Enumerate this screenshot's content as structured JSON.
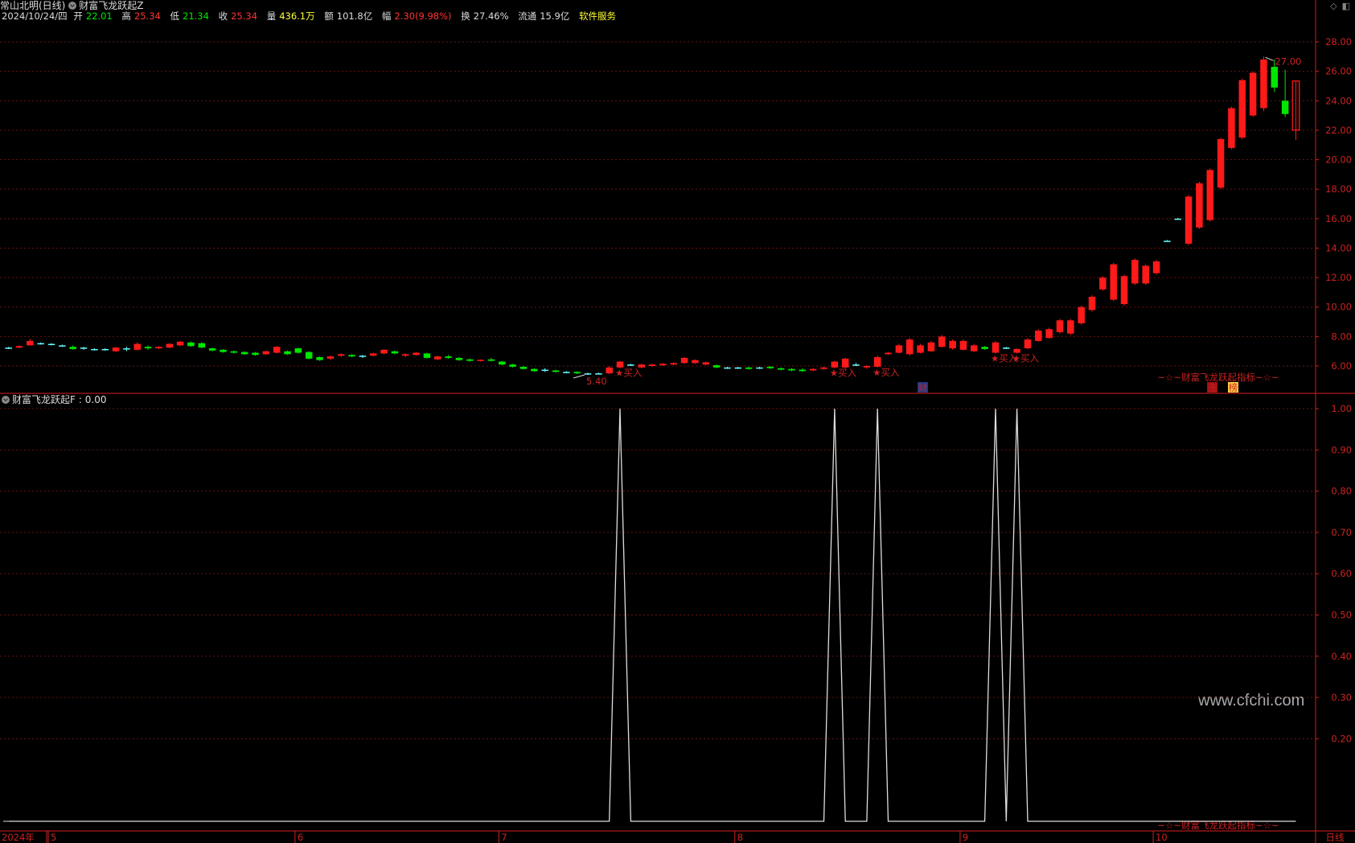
{
  "header": {
    "stock_name": "常山北明(日线)",
    "indicator_main": "财富飞龙跃起Z",
    "date": "2024/10/24/四",
    "open_label": "开",
    "open": "22.01",
    "high_label": "高",
    "high": "25.34",
    "low_label": "低",
    "low": "21.34",
    "close_label": "收",
    "close": "25.34",
    "volume_label": "量",
    "volume": "436.1万",
    "amount_label": "额",
    "amount": "101.8亿",
    "change_label": "幅",
    "change": "2.30(9.98%)",
    "turnover_label": "换",
    "turnover": "27.46%",
    "float_label": "流通",
    "float": "15.9亿",
    "service": "软件服务"
  },
  "toolbar_icons": [
    "diamond-icon",
    "window-icon"
  ],
  "sub_indicator": {
    "name": "财富飞龙跃起F",
    "value": ": 0.00"
  },
  "watermark": "www.cfchi.com",
  "period_label": "日线",
  "year_label": "2024年",
  "main_price_axis": [
    "28.00",
    "26.00",
    "24.00",
    "22.00",
    "20.00",
    "18.00",
    "16.00",
    "14.00",
    "12.00",
    "10.00",
    "8.00",
    "6.00"
  ],
  "sub_axis": [
    "1.00",
    "0.90",
    "0.80",
    "0.70",
    "0.60",
    "0.50",
    "0.40",
    "0.30",
    "0.20"
  ],
  "month_labels": [
    "5",
    "6",
    "7",
    "8",
    "9",
    "10"
  ],
  "annotations": {
    "max_price": "27.00",
    "min_price": "5.40",
    "buy_label": "买入",
    "bottom_banner": "~☆~财富飞龙跃起指标~☆~",
    "tag_cai": "财",
    "tag_zhang": "涨",
    "tag_bang": "榜"
  },
  "colors": {
    "up": "#ff1a1a",
    "down": "#00e600",
    "doji": "#66ffff",
    "axis": "#cc2222",
    "grid": "#6b1010",
    "signal": "#dddddd"
  },
  "chart_data": [
    {
      "type": "candlestick",
      "title": "财富飞龙跃起Z",
      "ylim": [
        5,
        28.5
      ],
      "ohlc": [
        [
          7.2,
          7.3,
          7.15,
          7.25
        ],
        [
          7.25,
          7.4,
          7.2,
          7.35
        ],
        [
          7.4,
          7.85,
          7.4,
          7.7
        ],
        [
          7.55,
          7.6,
          7.45,
          7.5
        ],
        [
          7.45,
          7.55,
          7.4,
          7.5
        ],
        [
          7.4,
          7.45,
          7.3,
          7.35
        ],
        [
          7.3,
          7.4,
          7.1,
          7.15
        ],
        [
          7.2,
          7.3,
          7.1,
          7.25
        ],
        [
          7.1,
          7.2,
          7.05,
          7.15
        ],
        [
          7.15,
          7.2,
          7.05,
          7.1
        ],
        [
          7.0,
          7.3,
          6.95,
          7.25
        ],
        [
          7.2,
          7.3,
          7.0,
          7.15
        ],
        [
          7.1,
          7.6,
          7.05,
          7.5
        ],
        [
          7.3,
          7.4,
          7.1,
          7.2
        ],
        [
          7.2,
          7.35,
          7.15,
          7.3
        ],
        [
          7.25,
          7.55,
          7.2,
          7.5
        ],
        [
          7.4,
          7.7,
          7.35,
          7.65
        ],
        [
          7.6,
          7.65,
          7.3,
          7.35
        ],
        [
          7.55,
          7.6,
          7.2,
          7.25
        ],
        [
          7.2,
          7.25,
          7.0,
          7.05
        ],
        [
          7.1,
          7.15,
          6.9,
          6.95
        ],
        [
          7.0,
          7.05,
          6.85,
          6.9
        ],
        [
          6.95,
          7.0,
          6.75,
          6.8
        ],
        [
          6.9,
          6.95,
          6.7,
          6.75
        ],
        [
          6.8,
          7.05,
          6.75,
          7.0
        ],
        [
          6.9,
          7.35,
          6.85,
          7.3
        ],
        [
          7.0,
          7.05,
          6.75,
          6.8
        ],
        [
          7.2,
          7.25,
          6.85,
          6.9
        ],
        [
          6.95,
          7.0,
          6.45,
          6.5
        ],
        [
          6.6,
          6.65,
          6.35,
          6.4
        ],
        [
          6.5,
          6.7,
          6.4,
          6.65
        ],
        [
          6.7,
          6.85,
          6.6,
          6.8
        ],
        [
          6.75,
          6.8,
          6.6,
          6.65
        ],
        [
          6.65,
          6.75,
          6.55,
          6.7
        ],
        [
          6.7,
          6.9,
          6.65,
          6.85
        ],
        [
          6.85,
          7.15,
          6.8,
          7.1
        ],
        [
          7.0,
          7.05,
          6.8,
          6.85
        ],
        [
          6.7,
          6.85,
          6.6,
          6.8
        ],
        [
          6.75,
          6.95,
          6.7,
          6.9
        ],
        [
          6.85,
          6.9,
          6.5,
          6.55
        ],
        [
          6.45,
          6.7,
          6.4,
          6.65
        ],
        [
          6.65,
          6.75,
          6.5,
          6.55
        ],
        [
          6.55,
          6.6,
          6.35,
          6.4
        ],
        [
          6.45,
          6.5,
          6.3,
          6.35
        ],
        [
          6.35,
          6.45,
          6.3,
          6.42
        ],
        [
          6.45,
          6.55,
          6.3,
          6.35
        ],
        [
          6.3,
          6.35,
          6.05,
          6.1
        ],
        [
          6.1,
          6.15,
          5.9,
          5.95
        ],
        [
          5.95,
          6.0,
          5.75,
          5.8
        ],
        [
          5.8,
          5.85,
          5.6,
          5.65
        ],
        [
          5.75,
          5.85,
          5.6,
          5.7
        ],
        [
          5.7,
          5.75,
          5.55,
          5.6
        ],
        [
          5.6,
          5.65,
          5.5,
          5.55
        ],
        [
          5.6,
          5.65,
          5.45,
          5.5
        ],
        [
          5.5,
          5.55,
          5.4,
          5.45
        ],
        [
          5.5,
          5.55,
          5.45,
          5.5
        ],
        [
          5.5,
          6.0,
          5.45,
          5.9
        ],
        [
          5.9,
          6.35,
          5.85,
          6.3
        ],
        [
          6.1,
          6.15,
          6.0,
          6.05
        ],
        [
          5.9,
          6.15,
          5.85,
          6.1
        ],
        [
          6.0,
          6.15,
          5.95,
          6.1
        ],
        [
          6.05,
          6.2,
          6.0,
          6.15
        ],
        [
          6.1,
          6.25,
          6.05,
          6.2
        ],
        [
          6.2,
          6.6,
          6.15,
          6.55
        ],
        [
          6.2,
          6.45,
          6.15,
          6.4
        ],
        [
          6.1,
          6.3,
          6.05,
          6.25
        ],
        [
          6.05,
          6.1,
          5.85,
          5.9
        ],
        [
          5.85,
          5.95,
          5.8,
          5.9
        ],
        [
          5.85,
          5.95,
          5.8,
          5.9
        ],
        [
          5.9,
          5.95,
          5.75,
          5.8
        ],
        [
          5.85,
          5.95,
          5.8,
          5.9
        ],
        [
          5.95,
          6.0,
          5.8,
          5.85
        ],
        [
          5.85,
          5.9,
          5.7,
          5.75
        ],
        [
          5.8,
          5.85,
          5.65,
          5.7
        ],
        [
          5.75,
          5.85,
          5.6,
          5.65
        ],
        [
          5.7,
          5.85,
          5.65,
          5.8
        ],
        [
          5.8,
          5.95,
          5.75,
          5.9
        ],
        [
          5.9,
          6.35,
          5.85,
          6.3
        ],
        [
          5.9,
          6.55,
          5.85,
          6.5
        ],
        [
          6.1,
          6.2,
          6.0,
          6.1
        ],
        [
          5.9,
          6.05,
          5.8,
          6.0
        ],
        [
          5.95,
          6.7,
          5.9,
          6.6
        ],
        [
          6.8,
          6.95,
          6.75,
          6.9
        ],
        [
          6.9,
          7.5,
          6.85,
          7.4
        ],
        [
          6.8,
          7.9,
          6.7,
          7.8
        ],
        [
          6.9,
          7.5,
          6.85,
          7.4
        ],
        [
          7.0,
          7.7,
          6.95,
          7.6
        ],
        [
          7.3,
          8.1,
          7.25,
          8.0
        ],
        [
          7.2,
          7.8,
          7.1,
          7.7
        ],
        [
          7.1,
          7.8,
          7.05,
          7.7
        ],
        [
          7.0,
          7.5,
          6.95,
          7.4
        ],
        [
          7.3,
          7.35,
          7.1,
          7.15
        ],
        [
          6.9,
          7.7,
          6.85,
          7.6
        ],
        [
          7.25,
          7.3,
          7.15,
          7.2
        ],
        [
          6.9,
          7.2,
          6.85,
          7.15
        ],
        [
          7.2,
          7.9,
          7.15,
          7.8
        ],
        [
          7.7,
          8.5,
          7.65,
          8.4
        ],
        [
          7.9,
          8.6,
          7.85,
          8.5
        ],
        [
          8.3,
          9.2,
          8.2,
          9.1
        ],
        [
          8.2,
          9.2,
          8.1,
          9.1
        ],
        [
          8.9,
          10.1,
          8.8,
          10.0
        ],
        [
          9.8,
          10.8,
          9.7,
          10.7
        ],
        [
          11.2,
          12.1,
          11.1,
          12.0
        ],
        [
          10.5,
          13.0,
          10.4,
          12.9
        ],
        [
          10.2,
          12.2,
          10.1,
          12.1
        ],
        [
          11.6,
          13.3,
          11.5,
          13.2
        ],
        [
          11.6,
          12.9,
          11.5,
          12.8
        ],
        [
          12.3,
          13.2,
          12.2,
          13.1
        ],
        [
          14.5,
          14.55,
          14.45,
          14.5
        ],
        [
          16.0,
          16.05,
          15.95,
          16.0
        ],
        [
          14.3,
          17.6,
          14.2,
          17.5
        ],
        [
          15.4,
          18.5,
          15.3,
          18.4
        ],
        [
          15.9,
          19.4,
          15.8,
          19.3
        ],
        [
          18.1,
          21.5,
          18.0,
          21.4
        ],
        [
          20.8,
          23.6,
          20.7,
          23.5
        ],
        [
          21.5,
          25.5,
          21.4,
          25.4
        ],
        [
          23.0,
          26.0,
          22.9,
          25.9
        ],
        [
          23.5,
          27.0,
          23.3,
          26.8
        ],
        [
          26.3,
          26.8,
          24.6,
          24.9
        ],
        [
          24.0,
          26.1,
          22.9,
          23.1
        ],
        [
          22.01,
          25.34,
          21.34,
          25.34
        ]
      ]
    },
    {
      "type": "line",
      "title": "财富飞龙跃起F",
      "ylim": [
        0,
        1.05
      ],
      "series": [
        {
          "values": [
            0,
            0,
            0,
            0,
            0,
            0,
            0,
            0,
            0,
            0,
            0,
            0,
            0,
            0,
            0,
            0,
            0,
            0,
            0,
            0,
            0,
            0,
            0,
            0,
            0,
            0,
            0,
            0,
            0,
            0,
            0,
            0,
            0,
            0,
            0,
            0,
            0,
            0,
            0,
            0,
            0,
            0,
            0,
            0,
            0,
            0,
            0,
            0,
            0,
            0,
            0,
            0,
            0,
            0,
            0,
            0,
            0,
            1,
            0,
            0,
            0,
            0,
            0,
            0,
            0,
            0,
            0,
            0,
            0,
            0,
            0,
            0,
            0,
            0,
            0,
            0,
            0,
            1,
            0,
            0,
            0,
            1,
            0,
            0,
            0,
            0,
            0,
            0,
            0,
            0,
            0,
            0,
            1,
            0,
            1,
            0,
            0,
            0,
            0,
            0,
            0,
            0,
            0,
            0,
            0,
            0,
            0,
            0,
            0,
            0,
            0,
            0,
            0,
            0,
            0,
            0,
            0,
            0,
            0,
            0,
            0
          ]
        }
      ]
    }
  ]
}
